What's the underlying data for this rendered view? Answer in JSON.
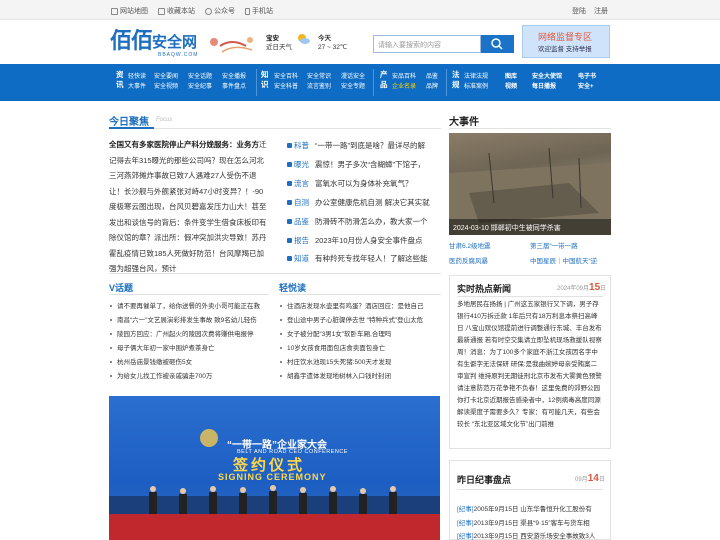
{
  "topbar": {
    "links": [
      "网站地图",
      "收藏本站",
      "公众号",
      "手机站"
    ],
    "login": "登陆",
    "register": "注册"
  },
  "header": {
    "logo_cn": "佰佰",
    "logo_cn2": "安全网",
    "logo_en": "BBAQW.COM",
    "weather_label": "宝安",
    "weather_sub": "近日天气",
    "today_label": "今天",
    "temp": "27 ~ 32℃",
    "search_placeholder": "请输入要搜索的内容",
    "promo_title": "网络监督专区",
    "promo_sub": "欢迎监督 支持举报"
  },
  "nav": {
    "g1": {
      "k": "资讯",
      "items": [
        "轻快读",
        "安全要闻",
        "安全话题",
        "安全播报",
        "大事件",
        "安全视频",
        "安全纪事",
        "事件盘点"
      ]
    },
    "g2": {
      "k": "知识",
      "items": [
        "安全百科",
        "安全常识",
        "漫话安全",
        "安全科普",
        "流言鉴别",
        "安全专题"
      ]
    },
    "g3": {
      "k": "产品",
      "items": [
        "安品百科",
        "品鉴",
        "企业名录",
        "品牌"
      ]
    },
    "g4": {
      "k": "法规",
      "items": [
        "法律法规",
        "图库",
        "安全大使馆",
        "电子书",
        "标准案例",
        "视频",
        "每日播报",
        "安全+"
      ]
    }
  },
  "focus": {
    "title": "今日聚焦",
    "badge": "Focus",
    "text_bold": "全国又有多家医院停止产科分娩服务：业务方",
    "text": "迁记得去年315曝光的那些公司吗？现在怎么河北三河燕郊摊炸事故已致7人遇难27人受伤不退让！长沙舰与外舰紧张对峙47小时变异？！-90度极寒云图出现，台风贝碧嘉发压力山大！甚至发出和谈信号的背后：条件变学生借食床板印有除仪馆的章？派出所：假冲突加洪灾导致！苏丹霍乱疫情已致185人死做好防范！台风摩羯已加强为超强台风，预计"
  },
  "cats": [
    {
      "label": "科普",
      "text": "“一带一路”到底是啥？最详尽的解"
    },
    {
      "label": "曝光",
      "text": "震惊！男子多次“含糊蟑”下馆子，"
    },
    {
      "label": "流言",
      "text": "富氧水可以为身体补充氧气？"
    },
    {
      "label": "自测",
      "text": "办公室健康危机自测 解决它其实就"
    },
    {
      "label": "品鉴",
      "text": "防滑砖不防滑怎么办，教大家一个"
    },
    {
      "label": "报告",
      "text": "2023年10月份人身安全事件盘点"
    },
    {
      "label": "知道",
      "text": "有种羚死专找年轻人！了解这些能"
    }
  ],
  "vtopic": {
    "title": "V话题",
    "items": [
      "请不要再催单了，给你送餐的外卖小哥可能正在救",
      "南昌“六一”文艺展演彩排发生事故 致9名幼儿轻伤",
      "陵园方回应：广州起火的陵园次费将赚供电报停",
      "母子俩大年初一家中围炉煮茶身亡",
      "杭州岳庙景钱缴被砸伤5女",
      "为给女儿找工作被亲戚骗走700万"
    ]
  },
  "light": {
    "title": "轻悦读",
    "items": [
      "住酒店发现水壶里有鸡蛋？酒店回应：是他自己",
      "登山途中男子心脏骤停去世 “特种兵式”登山太危",
      "女子被分配“3男1女”软卧车厢,合理吗",
      "10岁女孩食用面包店食卖面包身亡",
      "村庄饮水池现15头死猪:500天才发现",
      "胡鑫宇遗体发现地树林入口钱时封闭"
    ]
  },
  "photo": {
    "line1": "“一带一路”企业家大会",
    "line2": "BELT AND ROAD CEO CONFERENCE",
    "line3": "签约仪式",
    "line4": "SIGNING CEREMONY"
  },
  "bigevent": {
    "title": "大事件",
    "caption": "2024-03-10  邯郸初中生被同学杀害",
    "links": [
      "甘肃6.2级地震",
      "第三届“一带一路",
      "医药反腐风暴",
      "中国星辰｜中国航天“逆"
    ]
  },
  "hotnews": {
    "title": "实时热点新闻",
    "date_prefix": "2024年09月",
    "day": "15",
    "date_suffix": "日",
    "text": "多地居民在扬扬 | 广州这五家银行又下调，男子存银行410万拆迁款 1年后只有18万利息本祭扫高峰日 八宝山殡仪馆提前进行调整通行东城、丰台发布最新通报 若有时空交集请立即坠机现场救援队视察周！消息：为了100多个家庭不浙江女孩因名字中有生僻字无法保研 研保:是我曲婉婷母亲受贿案二审宣判 维持原判无期徒刑北京市发布大雾黄色预警 请注意防范万花争艳不负春！这里免费的郊野公园你打卡北京近期报告感染者中，12例病毒高度同源解读渠度子需要多久？专家：有可能几天，有些会较长 “东北亚区域文化节”出门前推"
  },
  "jishi": {
    "title": "昨日纪事盘点",
    "date_prefix": "09月",
    "day": "14",
    "date_suffix": "日",
    "rows": [
      {
        "tag": "[纪事]",
        "text": "2005年9月15日  山东华鲁恒升化工股份有"
      },
      {
        "tag": "[纪事]",
        "text": "2013年9月15日  渠县“9·15”客车与货车相"
      },
      {
        "tag": "[纪事]",
        "text": "2013年9月15日  西安游乐场安全事故致3人"
      }
    ]
  },
  "colors": {
    "brand": "#1e6fc0",
    "nav": "#0e6cc4",
    "accent": "#e0573c"
  }
}
